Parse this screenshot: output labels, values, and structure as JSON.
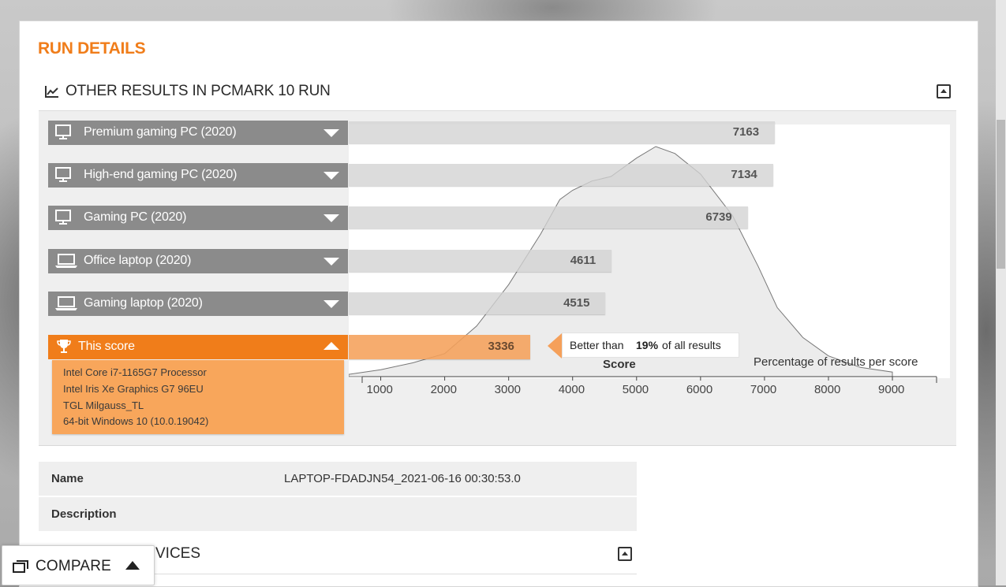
{
  "run_details": {
    "title": "RUN DETAILS"
  },
  "other_results": {
    "title": "OTHER RESULTS IN PCMARK 10 RUN",
    "rows": [
      {
        "label": "Premium gaming PC (2020)",
        "score": "7163",
        "icon": "desktop-icon"
      },
      {
        "label": "High-end gaming PC (2020)",
        "score": "7134",
        "icon": "desktop-icon"
      },
      {
        "label": "Gaming PC (2020)",
        "score": "6739",
        "icon": "desktop-icon"
      },
      {
        "label": "Office laptop (2020)",
        "score": "4611",
        "icon": "laptop-icon"
      },
      {
        "label": "Gaming laptop (2020)",
        "score": "4515",
        "icon": "laptop-icon"
      }
    ],
    "this_score": {
      "label": "This score",
      "score": "3336",
      "icon": "trophy-icon",
      "details": [
        "Intel Core i7-1165G7 Processor",
        "Intel Iris Xe Graphics G7 96EU",
        "TGL Milgauss_TL",
        "64-bit Windows 10 (10.0.19042)"
      ],
      "better_prefix": "Better than ",
      "better_pct": "19%",
      "better_suffix": " of all results"
    },
    "axis_title": "Score",
    "axis_note": "Percentage of results per score",
    "ticks": [
      "1000",
      "2000",
      "3000",
      "4000",
      "5000",
      "6000",
      "7000",
      "8000",
      "9000"
    ]
  },
  "info": {
    "rows": [
      {
        "key": "Name",
        "value": "LAPTOP-FDADJN54_2021-06-16 00:30:53.0"
      },
      {
        "key": "Description",
        "value": ""
      }
    ]
  },
  "devices": {
    "title": "VICES"
  },
  "compare": {
    "label": "COMPARE"
  },
  "colors": {
    "accent": "#f07d1a",
    "row_label": "#8b8b8b",
    "this_bar": "#f5a05a",
    "details_bg": "#f8a65b"
  },
  "chart_data": {
    "type": "bar",
    "categories": [
      "Premium gaming PC (2020)",
      "High-end gaming PC (2020)",
      "Gaming PC (2020)",
      "Office laptop (2020)",
      "Gaming laptop (2020)",
      "This score"
    ],
    "values": [
      7163,
      7134,
      6739,
      4611,
      4515,
      3336
    ],
    "xlabel": "Score",
    "ylabel": "Percentage of results per score",
    "xlim": [
      500,
      9900
    ],
    "distribution": {
      "x": [
        500,
        1000,
        1500,
        2000,
        2500,
        3000,
        3500,
        3800,
        4000,
        4300,
        4600,
        5000,
        5300,
        5600,
        6000,
        6500,
        6900,
        7200,
        7600,
        8000,
        8500,
        9000
      ],
      "y": [
        1,
        3,
        6,
        10,
        22,
        40,
        62,
        77,
        81,
        85,
        87,
        95,
        100,
        97,
        88,
        70,
        48,
        30,
        17,
        9,
        4,
        2
      ]
    }
  }
}
